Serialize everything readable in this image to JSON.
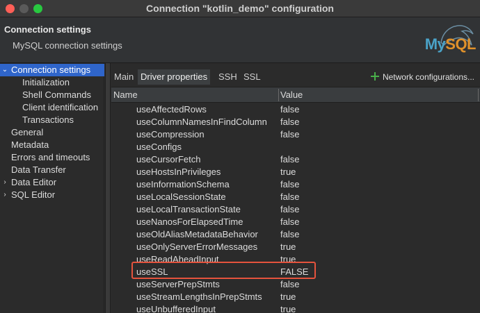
{
  "window": {
    "title": "Connection \"kotlin_demo\" configuration"
  },
  "header": {
    "title": "Connection settings",
    "subtitle": "MySQL connection settings",
    "logo_text_blue": "My",
    "logo_text_orange": "SQL"
  },
  "sidebar": {
    "items": [
      {
        "label": "Connection settings",
        "arrow": "⌄"
      },
      {
        "label": "Initialization"
      },
      {
        "label": "Shell Commands"
      },
      {
        "label": "Client identification"
      },
      {
        "label": "Transactions"
      },
      {
        "label": "General"
      },
      {
        "label": "Metadata"
      },
      {
        "label": "Errors and timeouts"
      },
      {
        "label": "Data Transfer"
      },
      {
        "label": "Data Editor",
        "arrow": "›"
      },
      {
        "label": "SQL Editor",
        "arrow": "›"
      }
    ]
  },
  "tabs": [
    {
      "label": "Main"
    },
    {
      "label": "Driver properties"
    },
    {
      "label": "SSH"
    },
    {
      "label": "SSL"
    }
  ],
  "network_configurations": "Network configurations...",
  "table": {
    "headers": {
      "name": "Name",
      "value": "Value"
    },
    "rows": [
      {
        "name": "useAffectedRows",
        "value": "false"
      },
      {
        "name": "useColumnNamesInFindColumn",
        "value": "false"
      },
      {
        "name": "useCompression",
        "value": "false"
      },
      {
        "name": "useConfigs",
        "value": ""
      },
      {
        "name": "useCursorFetch",
        "value": "false"
      },
      {
        "name": "useHostsInPrivileges",
        "value": "true"
      },
      {
        "name": "useInformationSchema",
        "value": "false"
      },
      {
        "name": "useLocalSessionState",
        "value": "false"
      },
      {
        "name": "useLocalTransactionState",
        "value": "false"
      },
      {
        "name": "useNanosForElapsedTime",
        "value": "false"
      },
      {
        "name": "useOldAliasMetadataBehavior",
        "value": "false"
      },
      {
        "name": "useOnlyServerErrorMessages",
        "value": "true"
      },
      {
        "name": "useReadAheadInput",
        "value": "true"
      },
      {
        "name": "useSSL",
        "value": "FALSE"
      },
      {
        "name": "useServerPrepStmts",
        "value": "false"
      },
      {
        "name": "useStreamLengthsInPrepStmts",
        "value": "true"
      },
      {
        "name": "useUnbufferedInput",
        "value": "true"
      }
    ]
  },
  "colors": {
    "selection": "#2f65ca",
    "highlight_border": "#e5533d",
    "add_icon": "#49b04a"
  }
}
